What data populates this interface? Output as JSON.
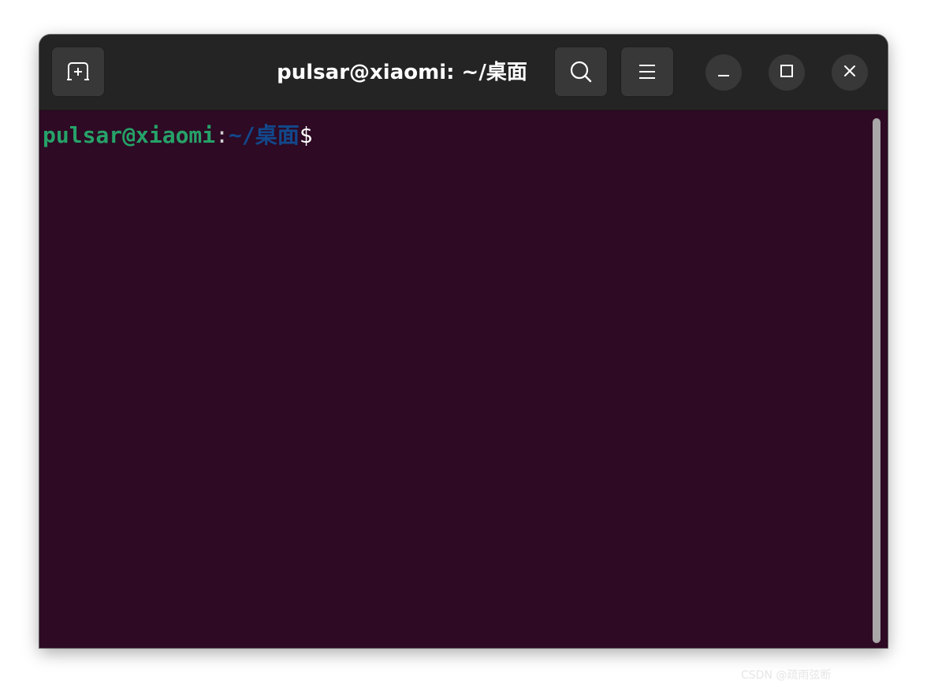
{
  "window": {
    "title": "pulsar@xiaomi: ~/桌面"
  },
  "titlebar": {
    "new_tab_icon": "new-tab-icon",
    "search_icon": "search-icon",
    "menu_icon": "hamburger-menu-icon",
    "minimize_icon": "minimize-icon",
    "maximize_icon": "maximize-icon",
    "close_icon": "close-icon"
  },
  "terminal": {
    "prompt_user_host": "pulsar@xiaomi",
    "prompt_colon": ":",
    "prompt_path": "~/桌面",
    "prompt_symbol": "$",
    "colors": {
      "background": "#2e0a24",
      "user_host": "#26a269",
      "path": "#12488b",
      "text": "#ffffff"
    }
  },
  "watermark": "CSDN @疏雨弦断"
}
